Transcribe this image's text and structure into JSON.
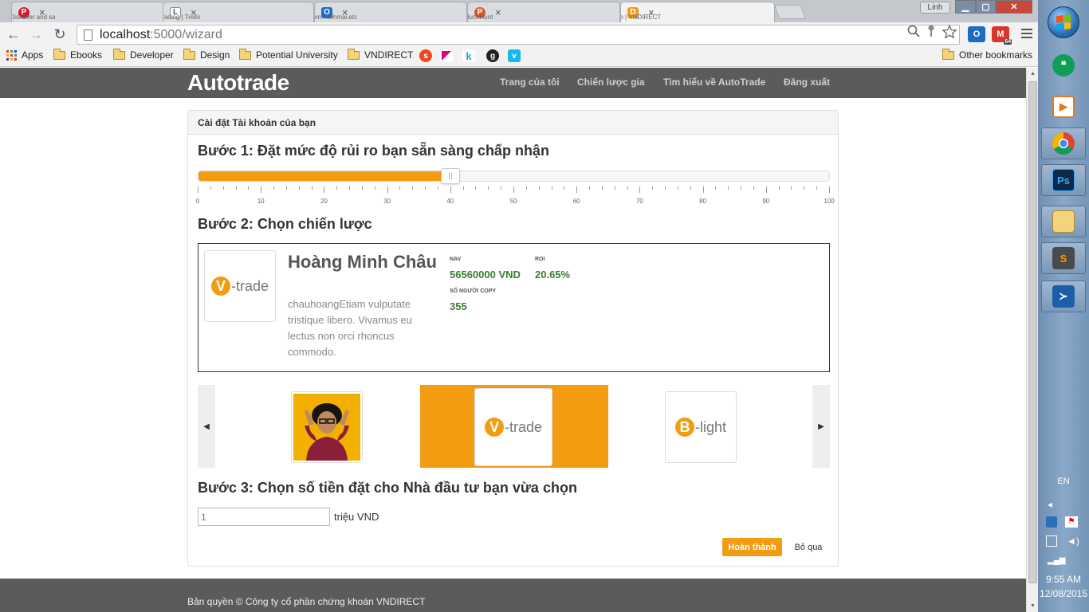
{
  "browser": {
    "tabs": [
      {
        "title": "Pinterest: Discover and sa",
        "icon": "pinterest-icon",
        "color": "#cb2027",
        "glyph": "P"
      },
      {
        "title": "Social Trading | Trello",
        "icon": "trello-icon",
        "color": "#b0b0b0",
        "glyph": "L"
      },
      {
        "title": "Outlook.com - linhmai.etc",
        "icon": "outlook-icon",
        "color": "#1e6bc4",
        "glyph": "O"
      },
      {
        "title": "Product Hunt",
        "icon": "product-hunt-icon",
        "color": "#da552f",
        "glyph": "P"
      },
      {
        "title": "AutoTrade | VNDIRECT",
        "icon": "vndirect-icon",
        "color": "#f39c12",
        "glyph": "D"
      }
    ],
    "tab_close": "×",
    "user_label": "Linh",
    "url_host": "localhost",
    "url_path": ":5000/wizard",
    "back": "←",
    "forward": "→",
    "reload": "↻",
    "omnibox_icons": [
      "search-icon",
      "key-icon",
      "star-icon"
    ],
    "extension_badge": "64",
    "bookmarks": [
      {
        "label": "Apps",
        "type": "apps"
      },
      {
        "label": "Ebooks",
        "type": "folder"
      },
      {
        "label": "Developer",
        "type": "folder"
      },
      {
        "label": "Design",
        "type": "folder"
      },
      {
        "label": "Potential University",
        "type": "folder"
      },
      {
        "label": "VNDIRECT",
        "type": "folder"
      }
    ],
    "other_bookmarks": "Other bookmarks"
  },
  "site": {
    "brand": "Autotrade",
    "nav": [
      "Trang của tôi",
      "Chiến lược gia",
      "Tìm hiểu về AutoTrade",
      "Đăng xuất"
    ],
    "accent": "#f39c12",
    "footer": "Bản quyền © Công ty cổ phần chứng khoán VNDIRECT"
  },
  "wizard": {
    "panel_title": "Cài đặt Tài khoản của bạn",
    "step1": "Bước 1: Đặt mức độ rủi ro bạn sẵn sàng chấp nhận",
    "risk_value": 40,
    "risk_min": 0,
    "risk_max": 100,
    "tick_labels": [
      "0",
      "10",
      "20",
      "30",
      "40",
      "50",
      "60",
      "70",
      "80",
      "90",
      "100"
    ],
    "step2": "Bước 2: Chọn chiến lược",
    "selected": {
      "name": "Hoàng Minh Châu",
      "logo_letter": "V",
      "logo_text": "-trade",
      "description": "chauhoangEtiam vulputate tristique libero. Vivamus eu lectus non orci rhoncus commodo.",
      "nav_label": "NAV",
      "nav_value": "56560000 VND",
      "roi_label": "ROI",
      "roi_value": "20.65%",
      "copy_label": "SỐ NGƯỜI COPY",
      "copy_value": "355"
    },
    "carousel": {
      "prev": "◀",
      "next": "▶",
      "items": [
        {
          "type": "photo"
        },
        {
          "type": "logo",
          "letter": "V",
          "text": "-trade",
          "selected": true
        },
        {
          "type": "logo",
          "letter": "B",
          "text": "-light"
        }
      ]
    },
    "step3": "Bước 3: Chọn số tiền đặt cho Nhà đầu tư bạn vừa chọn",
    "amount_placeholder": "1",
    "amount_unit": "triệu VND",
    "done_button": "Hoàn thành",
    "skip_button": "Bỏ qua"
  },
  "taskbar": {
    "apps": [
      "hangouts-icon",
      "media-player-icon",
      "chrome-icon",
      "photoshop-icon",
      "file-explorer-icon",
      "sublime-text-icon",
      "powershell-icon"
    ],
    "photoshop_label": "Ps",
    "language": "EN",
    "tray_arrow": "◂",
    "time": "9:55 AM",
    "date": "12/08/2015"
  }
}
